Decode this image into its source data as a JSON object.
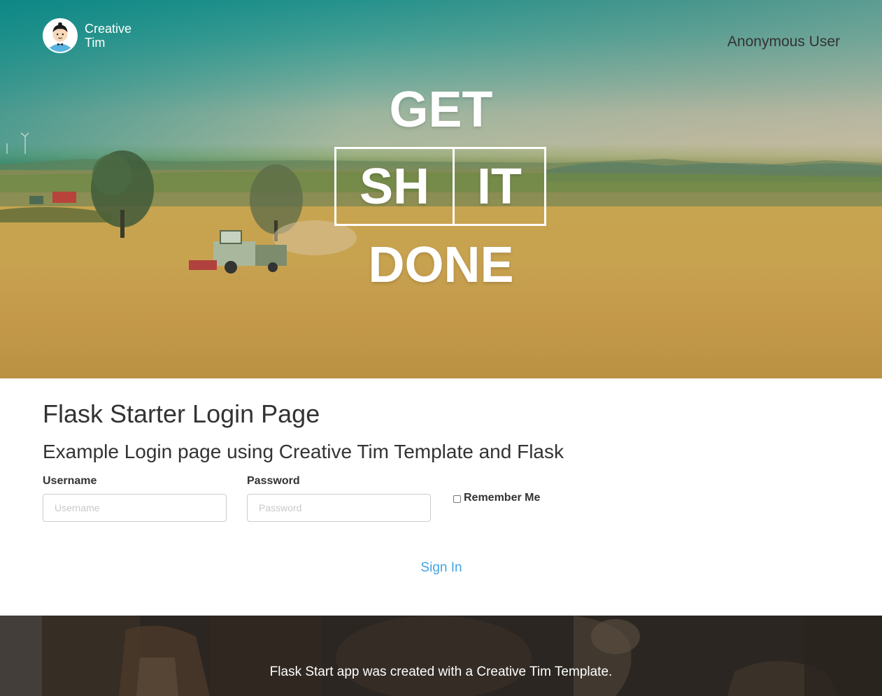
{
  "brand": {
    "name_line1": "Creative",
    "name_line2": "Tim"
  },
  "nav": {
    "user_label": "Anonymous User"
  },
  "hero": {
    "line1": "GET",
    "box_left": "SH",
    "box_right": "IT",
    "line3": "DONE"
  },
  "main": {
    "title": "Flask Starter Login Page",
    "subtitle": "Example Login page using Creative Tim Template and Flask"
  },
  "form": {
    "username_label": "Username",
    "username_placeholder": "Username",
    "username_value": "",
    "password_label": "Password",
    "password_placeholder": "Password",
    "password_value": "",
    "remember_label": "Remember Me",
    "remember_checked": false,
    "submit_label": "Sign In"
  },
  "footer": {
    "text": "Flask Start app was created with a Creative Tim Template."
  },
  "colors": {
    "link": "#42a3e0",
    "text": "#333333",
    "footer_bg": "#2a2520"
  }
}
